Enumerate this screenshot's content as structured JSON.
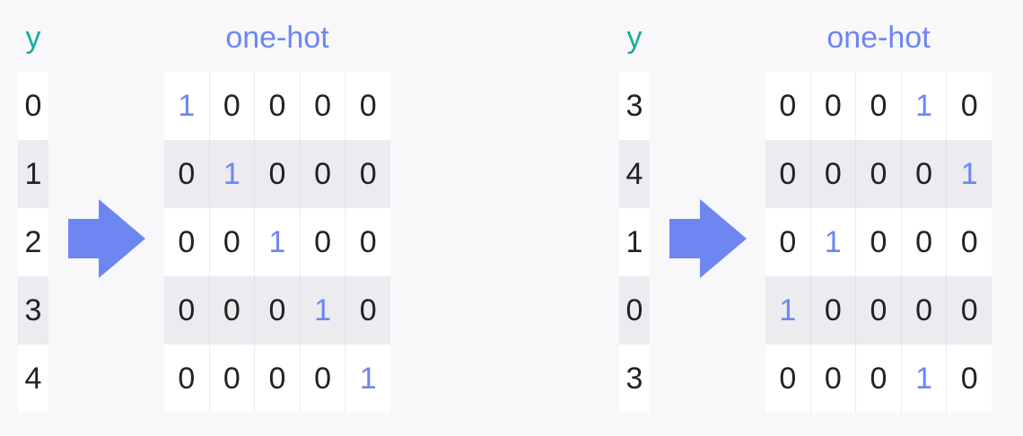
{
  "colors": {
    "y_header": "#1aab9f",
    "onehot_header": "#6e86f0",
    "hot_value": "#6e86f0",
    "arrow": "#6e86f0",
    "row_alt": "#ebebf0",
    "row": "#ffffff"
  },
  "icons": {
    "arrow": "right-arrow-icon"
  },
  "panels": [
    {
      "y_header": "y",
      "onehot_header": "one-hot",
      "rows": [
        {
          "y": "0",
          "bits": [
            "1",
            "0",
            "0",
            "0",
            "0"
          ],
          "hot": 0
        },
        {
          "y": "1",
          "bits": [
            "0",
            "1",
            "0",
            "0",
            "0"
          ],
          "hot": 1
        },
        {
          "y": "2",
          "bits": [
            "0",
            "0",
            "1",
            "0",
            "0"
          ],
          "hot": 2
        },
        {
          "y": "3",
          "bits": [
            "0",
            "0",
            "0",
            "1",
            "0"
          ],
          "hot": 3
        },
        {
          "y": "4",
          "bits": [
            "0",
            "0",
            "0",
            "0",
            "1"
          ],
          "hot": 4
        }
      ]
    },
    {
      "y_header": "y",
      "onehot_header": "one-hot",
      "rows": [
        {
          "y": "3",
          "bits": [
            "0",
            "0",
            "0",
            "1",
            "0"
          ],
          "hot": 3
        },
        {
          "y": "4",
          "bits": [
            "0",
            "0",
            "0",
            "0",
            "1"
          ],
          "hot": 4
        },
        {
          "y": "1",
          "bits": [
            "0",
            "1",
            "0",
            "0",
            "0"
          ],
          "hot": 1
        },
        {
          "y": "0",
          "bits": [
            "1",
            "0",
            "0",
            "0",
            "0"
          ],
          "hot": 0
        },
        {
          "y": "3",
          "bits": [
            "0",
            "0",
            "0",
            "1",
            "0"
          ],
          "hot": 3
        }
      ]
    }
  ]
}
